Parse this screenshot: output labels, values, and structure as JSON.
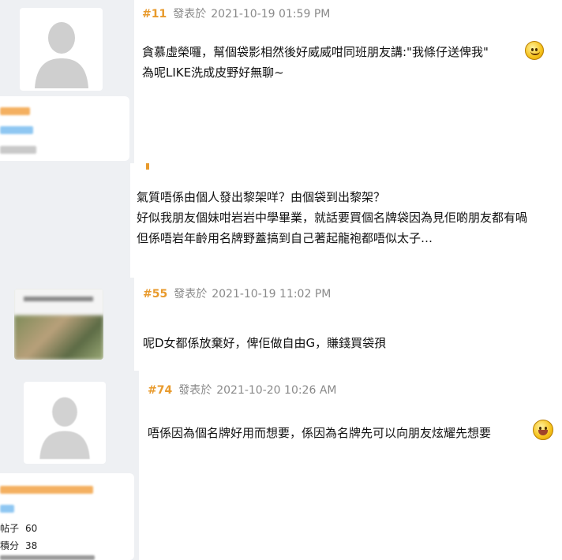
{
  "posts": [
    {
      "floor": "#11",
      "posted_label": "發表於",
      "timestamp": "2021-10-19 01:59 PM",
      "lines": [
        "貪慕虛榮囉，幫個袋影相然後好威威咁同班朋友講:\"我條仔送俾我\"",
        "為呢LIKE洗成皮野好無聊~"
      ],
      "emoji": "shy-smiley-icon"
    },
    {
      "floor": "",
      "lines": [
        "氣質唔係由個人發出黎架咩？由個袋到出黎架？",
        "好似我朋友個妹咁岩岩中學畢業，就話要買個名牌袋因為見佢啲朋友都有喎",
        "但係唔岩年齡用名牌野蓋搞到自己著起龍袍都唔似太子…"
      ]
    },
    {
      "floor": "#55",
      "posted_label": "發表於",
      "timestamp": "2021-10-19 11:02 PM",
      "lines": [
        "呢D女都係放棄好，俾佢做自由G，賺錢買袋孭"
      ]
    },
    {
      "floor": "#74",
      "posted_label": "發表於",
      "timestamp": "2021-10-20 10:26 AM",
      "lines": [
        "唔係因為個名牌好用而想要，係因為名牌先可以向朋友炫耀先想要"
      ],
      "emoji": "laughing-smiley-icon",
      "stats": {
        "posts_label": "帖子",
        "posts_value": "60",
        "points_label": "積分",
        "points_value": "38"
      }
    }
  ],
  "colors": {
    "floor": "#e89a2c",
    "meta": "#8a8a8a",
    "sidebar": "#eef0f3"
  }
}
